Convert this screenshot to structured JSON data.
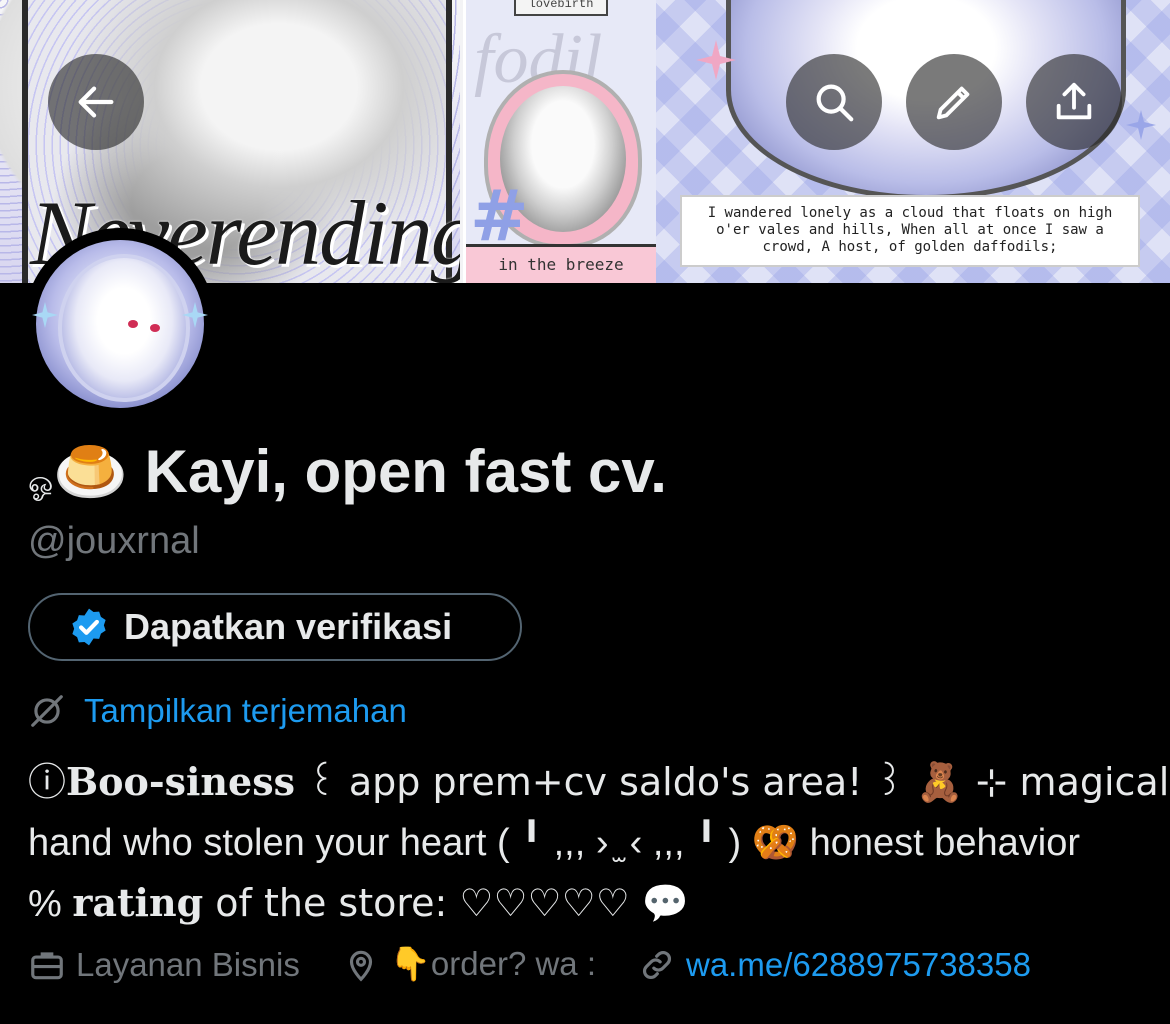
{
  "banner": {
    "panel1_script": "Neverending",
    "panel2_topcap": "lovebirth",
    "panel2_ghost": "fodil",
    "panel2_hash": "#",
    "panel2_caption": "in the breeze",
    "panel3_quote": "I wandered lonely as a cloud that floats on high o'er vales and hills, When all at once I saw a crowd, A host, of golden daffodils;"
  },
  "toolbar": {
    "back_icon": "arrow-left-icon",
    "search_icon": "search-icon",
    "edit_icon": "pencil-icon",
    "share_icon": "share-icon"
  },
  "profile": {
    "name_emoji": "🍮",
    "name_prefix": "ஓ",
    "name": "Kayi, open fast cv.",
    "handle": "@jouxrnal",
    "verify_label": "Dapatkan verifikasi",
    "translate_label": "Tampilkan terjemahan",
    "bio": {
      "line1_a": "ⓘ",
      "line1_bold": "Boo-siness",
      "line1_b": "  ꒰ app prem+cv saldo's area! ꒱ 🧸 ⊹ magical",
      "line2": "hand who stolen your heart ( ╹ ,,, › ̫ ‹ ,,, ╹ ) 🥨 honest behavior",
      "line3_a": "% ",
      "line3_bold": "rating",
      "line3_b": " of the store: ♡♡♡♡♡ 💬"
    },
    "meta": {
      "category": "Layanan Bisnis",
      "location": "👇order? wa :",
      "link": "wa.me/6288975738358"
    }
  },
  "colors": {
    "background": "#000000",
    "text": "#e7e9ea",
    "muted": "#71767b",
    "link": "#1d9bf0",
    "verified": "#1d9bf0"
  }
}
